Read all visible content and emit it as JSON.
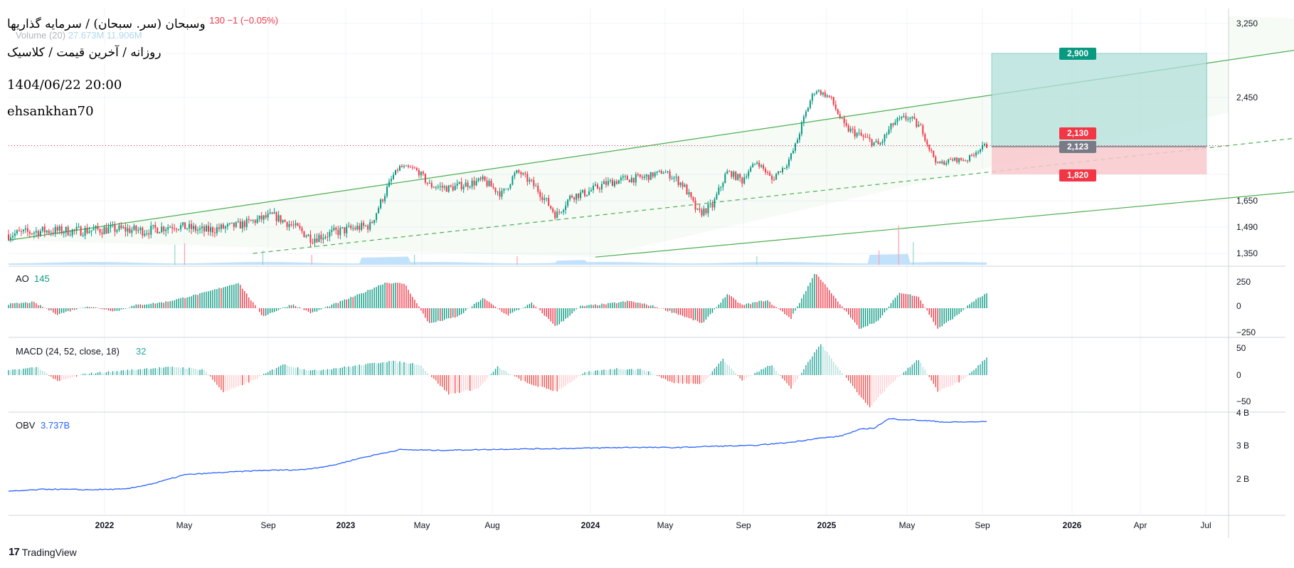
{
  "header": {
    "symbol_line": "وسبحان (سر. سبحان) / سرمایه گذاریها",
    "subtitle_line": "روزانه / آخرین قیمت / کلاسیک",
    "datetime": "1404/06/22 20:00",
    "author": "ehsankhan70",
    "ohlc_close": "C2,130",
    "ohlc_change": "−1 (−0.05%)",
    "volume_label": "Volume (20)",
    "volume_values": "27.673M  11.906M"
  },
  "brand": {
    "logo_text": "17",
    "name": "TradingView"
  },
  "price_tags": [
    {
      "value": "2,900",
      "color": "#089981"
    },
    {
      "value": "2,130",
      "color": "#f23645"
    },
    {
      "value": "2,123",
      "color": "#787b86"
    },
    {
      "value": "1,820",
      "color": "#f23645"
    }
  ],
  "colors": {
    "up": "#089981",
    "down": "#f23645",
    "channel": "#4caf50",
    "ao_up": "#089981",
    "ao_down": "#f23645",
    "macd_up": "#26a69a",
    "macd_down": "#ef5350",
    "obv": "#2962ff",
    "volume": "#90caf9",
    "target": "#b2dfdb",
    "stop": "#f8c8cc"
  },
  "chart_data": [
    {
      "type": "candlestick",
      "title": "",
      "x_ticks": [
        "2022",
        "May",
        "Sep",
        "2023",
        "May",
        "Aug",
        "2024",
        "May",
        "Sep",
        "2025",
        "May",
        "Sep",
        "2026",
        "Apr",
        "Jul"
      ],
      "y_ticks": [
        "3,250",
        "2,900",
        "2,450",
        "2,123",
        "1,820",
        "1,650",
        "1,490",
        "1,350"
      ],
      "ylim": [
        1300,
        3350
      ],
      "last_close": 2130,
      "series_path": [
        [
          0,
          1450
        ],
        [
          0.07,
          1470
        ],
        [
          0.14,
          1470
        ],
        [
          0.22,
          1480
        ],
        [
          0.28,
          1470
        ],
        [
          0.34,
          1500
        ],
        [
          0.4,
          1470
        ],
        [
          0.47,
          1500
        ],
        [
          0.54,
          1560
        ],
        [
          0.58,
          1500
        ],
        [
          0.62,
          1430
        ],
        [
          0.68,
          1470
        ],
        [
          0.72,
          1490
        ],
        [
          0.74,
          1500
        ],
        [
          0.77,
          1700
        ],
        [
          0.8,
          1900
        ],
        [
          0.83,
          1880
        ],
        [
          0.86,
          1750
        ],
        [
          0.9,
          1730
        ],
        [
          0.94,
          1760
        ],
        [
          0.97,
          1780
        ],
        [
          1.01,
          1690
        ],
        [
          1.04,
          1850
        ],
        [
          1.08,
          1730
        ],
        [
          1.12,
          1560
        ],
        [
          1.15,
          1680
        ],
        [
          1.18,
          1700
        ],
        [
          1.22,
          1760
        ],
        [
          1.26,
          1790
        ],
        [
          1.3,
          1800
        ],
        [
          1.34,
          1850
        ],
        [
          1.38,
          1750
        ],
        [
          1.41,
          1570
        ],
        [
          1.44,
          1620
        ],
        [
          1.47,
          1850
        ],
        [
          1.5,
          1780
        ],
        [
          1.53,
          1960
        ],
        [
          1.56,
          1780
        ],
        [
          1.59,
          1920
        ],
        [
          1.62,
          2250
        ],
        [
          1.65,
          2530
        ],
        [
          1.68,
          2450
        ],
        [
          1.71,
          2250
        ],
        [
          1.75,
          2180
        ],
        [
          1.78,
          2130
        ],
        [
          1.81,
          2280
        ],
        [
          1.84,
          2320
        ],
        [
          1.87,
          2230
        ],
        [
          1.9,
          1930
        ],
        [
          1.93,
          1980
        ],
        [
          1.96,
          1980
        ],
        [
          1.98,
          2080
        ],
        [
          2.0,
          2130
        ]
      ],
      "target_box": {
        "top": 2900,
        "entry": 2123,
        "stop": 1820,
        "x_start": 2.0,
        "x_end": 2.45
      },
      "channel": {
        "upper": [
          [
            0.0,
            1420
          ],
          [
            3.0,
            3250
          ]
        ],
        "middle": [
          [
            0.5,
            1350
          ],
          [
            4.2,
            2900
          ]
        ],
        "lower": [
          [
            1.2,
            1330
          ],
          [
            4.2,
            2300
          ]
        ]
      }
    },
    {
      "type": "bar",
      "title": "Volume (20)",
      "values": [
        "27.673M",
        "11.906M"
      ]
    },
    {
      "type": "bar",
      "title": "AO",
      "last_value": "145",
      "y_ticks": [
        "250",
        "0",
        "−250"
      ],
      "ylim": [
        -260,
        260
      ],
      "anchors": [
        [
          0,
          40
        ],
        [
          0.05,
          60
        ],
        [
          0.1,
          -60
        ],
        [
          0.16,
          20
        ],
        [
          0.22,
          -30
        ],
        [
          0.26,
          30
        ],
        [
          0.32,
          60
        ],
        [
          0.4,
          150
        ],
        [
          0.47,
          250
        ],
        [
          0.52,
          -80
        ],
        [
          0.58,
          40
        ],
        [
          0.62,
          -50
        ],
        [
          0.66,
          30
        ],
        [
          0.72,
          140
        ],
        [
          0.77,
          250
        ],
        [
          0.81,
          240
        ],
        [
          0.86,
          -150
        ],
        [
          0.92,
          -80
        ],
        [
          0.97,
          100
        ],
        [
          1.02,
          -70
        ],
        [
          1.07,
          50
        ],
        [
          1.12,
          -180
        ],
        [
          1.17,
          20
        ],
        [
          1.22,
          40
        ],
        [
          1.27,
          70
        ],
        [
          1.32,
          20
        ],
        [
          1.37,
          -60
        ],
        [
          1.42,
          -150
        ],
        [
          1.47,
          140
        ],
        [
          1.5,
          30
        ],
        [
          1.55,
          80
        ],
        [
          1.6,
          -100
        ],
        [
          1.65,
          350
        ],
        [
          1.69,
          100
        ],
        [
          1.74,
          -200
        ],
        [
          1.78,
          -120
        ],
        [
          1.82,
          150
        ],
        [
          1.86,
          120
        ],
        [
          1.9,
          -200
        ],
        [
          1.94,
          -70
        ],
        [
          1.97,
          60
        ],
        [
          2.0,
          145
        ]
      ]
    },
    {
      "type": "bar",
      "title": "MACD (24, 52, close, 18)",
      "last_value": "32",
      "y_ticks": [
        "50",
        "0",
        "−50"
      ],
      "ylim": [
        -65,
        65
      ],
      "anchors": [
        [
          0,
          8
        ],
        [
          0.06,
          15
        ],
        [
          0.1,
          -12
        ],
        [
          0.16,
          3
        ],
        [
          0.22,
          7
        ],
        [
          0.28,
          12
        ],
        [
          0.34,
          15
        ],
        [
          0.4,
          10
        ],
        [
          0.44,
          -32
        ],
        [
          0.5,
          -10
        ],
        [
          0.56,
          20
        ],
        [
          0.62,
          8
        ],
        [
          0.7,
          16
        ],
        [
          0.78,
          26
        ],
        [
          0.84,
          20
        ],
        [
          0.9,
          -35
        ],
        [
          0.96,
          -25
        ],
        [
          1.0,
          15
        ],
        [
          1.06,
          -15
        ],
        [
          1.12,
          -30
        ],
        [
          1.18,
          5
        ],
        [
          1.24,
          12
        ],
        [
          1.3,
          10
        ],
        [
          1.36,
          -15
        ],
        [
          1.42,
          -15
        ],
        [
          1.46,
          30
        ],
        [
          1.5,
          -10
        ],
        [
          1.56,
          20
        ],
        [
          1.6,
          -25
        ],
        [
          1.66,
          58
        ],
        [
          1.7,
          10
        ],
        [
          1.76,
          -60
        ],
        [
          1.8,
          -20
        ],
        [
          1.86,
          30
        ],
        [
          1.9,
          -30
        ],
        [
          1.95,
          -10
        ],
        [
          2.0,
          32
        ]
      ]
    },
    {
      "type": "line",
      "title": "OBV",
      "last_value": "3.737B",
      "y_ticks": [
        "4 B",
        "3 B",
        "2 B"
      ],
      "ylim": [
        1.5,
        4.0
      ],
      "series": [
        [
          0,
          1.65
        ],
        [
          0.08,
          1.72
        ],
        [
          0.16,
          1.7
        ],
        [
          0.24,
          1.72
        ],
        [
          0.3,
          1.9
        ],
        [
          0.36,
          2.15
        ],
        [
          0.44,
          2.22
        ],
        [
          0.52,
          2.28
        ],
        [
          0.6,
          2.3
        ],
        [
          0.66,
          2.42
        ],
        [
          0.72,
          2.65
        ],
        [
          0.8,
          2.9
        ],
        [
          0.88,
          2.88
        ],
        [
          0.96,
          2.9
        ],
        [
          1.04,
          2.92
        ],
        [
          1.12,
          2.93
        ],
        [
          1.2,
          2.95
        ],
        [
          1.28,
          2.97
        ],
        [
          1.36,
          2.96
        ],
        [
          1.44,
          3.0
        ],
        [
          1.52,
          3.02
        ],
        [
          1.6,
          3.12
        ],
        [
          1.65,
          3.23
        ],
        [
          1.7,
          3.3
        ],
        [
          1.74,
          3.5
        ],
        [
          1.77,
          3.55
        ],
        [
          1.8,
          3.82
        ],
        [
          1.86,
          3.78
        ],
        [
          1.92,
          3.72
        ],
        [
          1.97,
          3.73
        ],
        [
          2.0,
          3.737
        ]
      ]
    }
  ]
}
